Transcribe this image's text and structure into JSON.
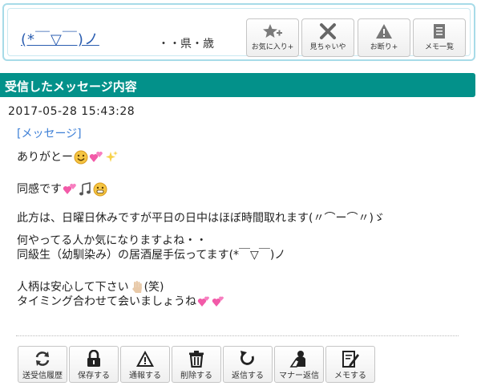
{
  "profile": {
    "nickname": "(*￣▽￣)ノ",
    "location": "・・県・歳",
    "actions": [
      {
        "label": "お気に入り+",
        "icon": "star-plus-icon"
      },
      {
        "label": "見ちゃいや",
        "icon": "cross-icon"
      },
      {
        "label": "お断り+",
        "icon": "warning-icon"
      },
      {
        "label": "メモ一覧",
        "icon": "memo-icon"
      }
    ]
  },
  "section": {
    "title": "受信したメッセージ内容"
  },
  "message": {
    "timestamp": "2017-05-28 15:43:28",
    "heading": "[メッセージ]",
    "lines": [
      "ありがとー",
      "同感です",
      "此方は、日曜日休みですが平日の日中はほぼ時間取れます(〃⌒ー⌒〃)ゞ",
      "何やってる人か気になりますよね・・",
      "同級生（幼馴染み）の居酒屋手伝ってます(*￣▽￣)ノ",
      "人柄は安心して下さい",
      "(笑)",
      "タイミング合わせて会いましょうね"
    ]
  },
  "toolbar": [
    {
      "label": "送受信履歴",
      "icon": "refresh-icon"
    },
    {
      "label": "保存する",
      "icon": "lock-icon"
    },
    {
      "label": "通報する",
      "icon": "warning-icon"
    },
    {
      "label": "削除する",
      "icon": "trash-icon"
    },
    {
      "label": "返信する",
      "icon": "reply-icon"
    },
    {
      "label": "マナー返信",
      "icon": "manner-reply-icon"
    },
    {
      "label": "メモする",
      "icon": "memo-edit-icon"
    }
  ],
  "colors": {
    "section_bar": "#03918a",
    "link": "#3d7fd6",
    "frame": "#a7dbe8"
  }
}
